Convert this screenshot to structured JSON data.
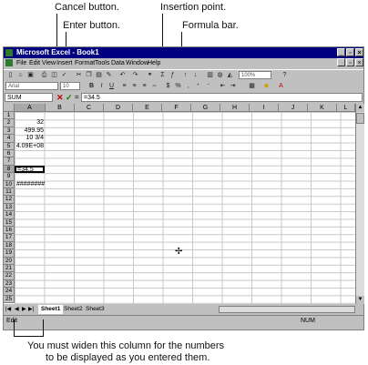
{
  "callouts": {
    "cancel": "Cancel button.",
    "enter": "Enter button.",
    "insertion": "Insertion point.",
    "formula": "Formula bar.",
    "bottom_line1": "You must widen this column for the numbers",
    "bottom_line2": "to be displayed as you entered them."
  },
  "window": {
    "title": "Microsoft Excel - Book1"
  },
  "menu": [
    "File",
    "Edit",
    "View",
    "Insert",
    "Format",
    "Tools",
    "Data",
    "Window",
    "Help"
  ],
  "toolbar": {
    "zoom": "100%",
    "font": "Arial",
    "font_size": "10"
  },
  "formula_bar": {
    "name_box": "SUM",
    "equals": "=",
    "content": "=34.5"
  },
  "columns": [
    "A",
    "B",
    "C",
    "D",
    "E",
    "F",
    "G",
    "H",
    "I",
    "J",
    "K",
    "L"
  ],
  "rows": [
    "1",
    "2",
    "3",
    "4",
    "5",
    "6",
    "7",
    "8",
    "9",
    "10",
    "11",
    "12",
    "13",
    "14",
    "15",
    "16",
    "17",
    "18",
    "19",
    "20",
    "21",
    "22",
    "23",
    "24",
    "25"
  ],
  "cells": {
    "a2": "32",
    "a3": "499.95",
    "a4": "10 3/4",
    "a5": "4.09E+08",
    "a8": "=34.5",
    "a10": "########"
  },
  "sheets": [
    "Sheet1",
    "Sheet2",
    "Sheet3"
  ],
  "status": {
    "mode": "Edit",
    "num": "NUM"
  },
  "colors": {
    "titlebar": "#000080",
    "window": "#c0c0c0",
    "cancel": "#c00000",
    "enter": "#008000"
  }
}
